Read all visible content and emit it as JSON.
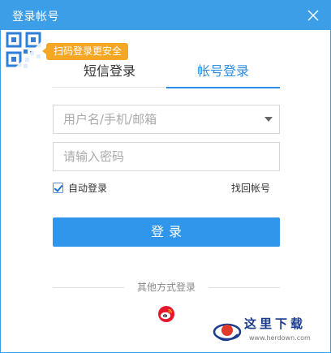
{
  "window": {
    "title": "登录帐号"
  },
  "qr": {
    "tip": "扫码登录更安全"
  },
  "tabs": [
    {
      "label": "短信登录",
      "active": false
    },
    {
      "label": "帐号登录",
      "active": true
    }
  ],
  "form": {
    "username_placeholder": "用户名/手机/邮箱",
    "username_value": "",
    "password_placeholder": "请输入密码",
    "password_value": "",
    "auto_login_label": "自动登录",
    "auto_login_checked": true,
    "forgot_label": "找回帐号",
    "login_button": "登录"
  },
  "other_login": {
    "label": "其他方式登录",
    "providers": [
      "weibo-icon"
    ]
  },
  "watermark": {
    "brand": "这里下载",
    "url": "www.herdown.com"
  },
  "colors": {
    "title_bar": "#3d9ee8",
    "accent": "#2a8ee2",
    "button": "#2f96ec",
    "tip": "#f5a623",
    "weibo": "#e6162d"
  }
}
